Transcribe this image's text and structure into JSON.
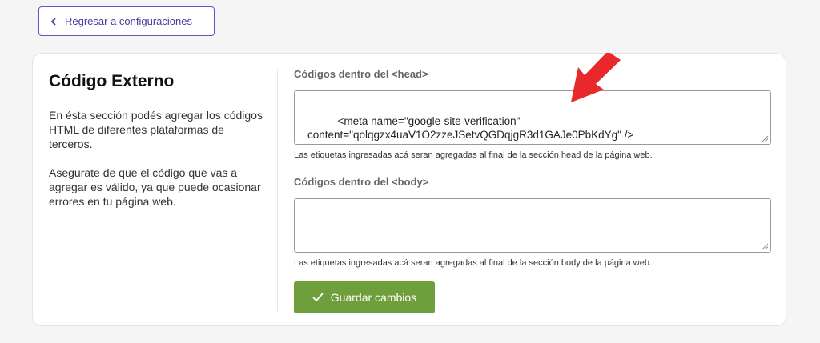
{
  "nav": {
    "back_label": "Regresar a configuraciones"
  },
  "section": {
    "title": "Código Externo",
    "description_1": "En ésta sección podés agregar los códigos HTML de diferentes plataformas de terceros.",
    "description_2": "Asegurate de que el código que vas a agregar es válido, ya que puede ocasionar errores en tu página web."
  },
  "head_field": {
    "label": "Códigos dentro del <head>",
    "value": "<meta name=\"google-site-verification\"\ncontent=\"qolqgzx4uaV1O2zzeJSetvQGDqjgR3d1GAJe0PbKdYg\" />",
    "help": "Las etiquetas ingresadas acá seran agregadas al final de la sección head de la página web."
  },
  "body_field": {
    "label": "Códigos dentro del <body>",
    "value": "",
    "help": "Las etiquetas ingresadas acá seran agregadas al final de la sección body de la página web."
  },
  "actions": {
    "save_label": "Guardar cambios"
  },
  "icons": {
    "back": "chevron-left-icon",
    "save": "check-icon",
    "annotation": "red-arrow-icon"
  },
  "colors": {
    "accent_purple": "#6b4fc8",
    "save_green": "#6e9f3c",
    "annotation_red": "#e8282a"
  }
}
